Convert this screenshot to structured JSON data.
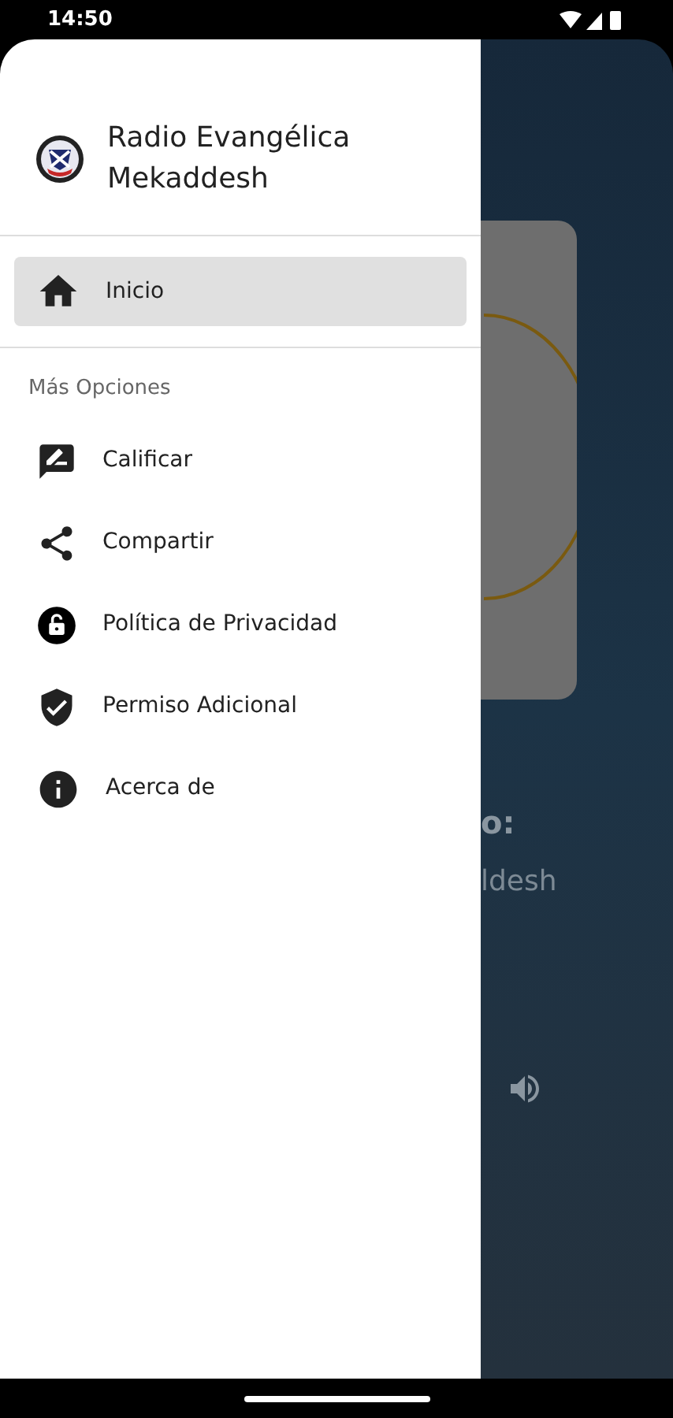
{
  "status_bar": {
    "time": "14:50"
  },
  "drawer": {
    "header": {
      "title": "Radio Evangélica Mekaddesh"
    },
    "main_items": [
      {
        "label": "Inicio",
        "selected": true
      }
    ],
    "section_title": "Más Opciones",
    "more_items": [
      {
        "label": "Calificar",
        "selected": false
      },
      {
        "label": "Compartir",
        "selected": false
      },
      {
        "label": "Política de Privacidad",
        "selected": false
      },
      {
        "label": "Permiso Adicional",
        "selected": false
      },
      {
        "label": "Acerca de",
        "selected": false
      }
    ]
  },
  "player": {
    "heading": "o:",
    "station": "ldesh"
  }
}
